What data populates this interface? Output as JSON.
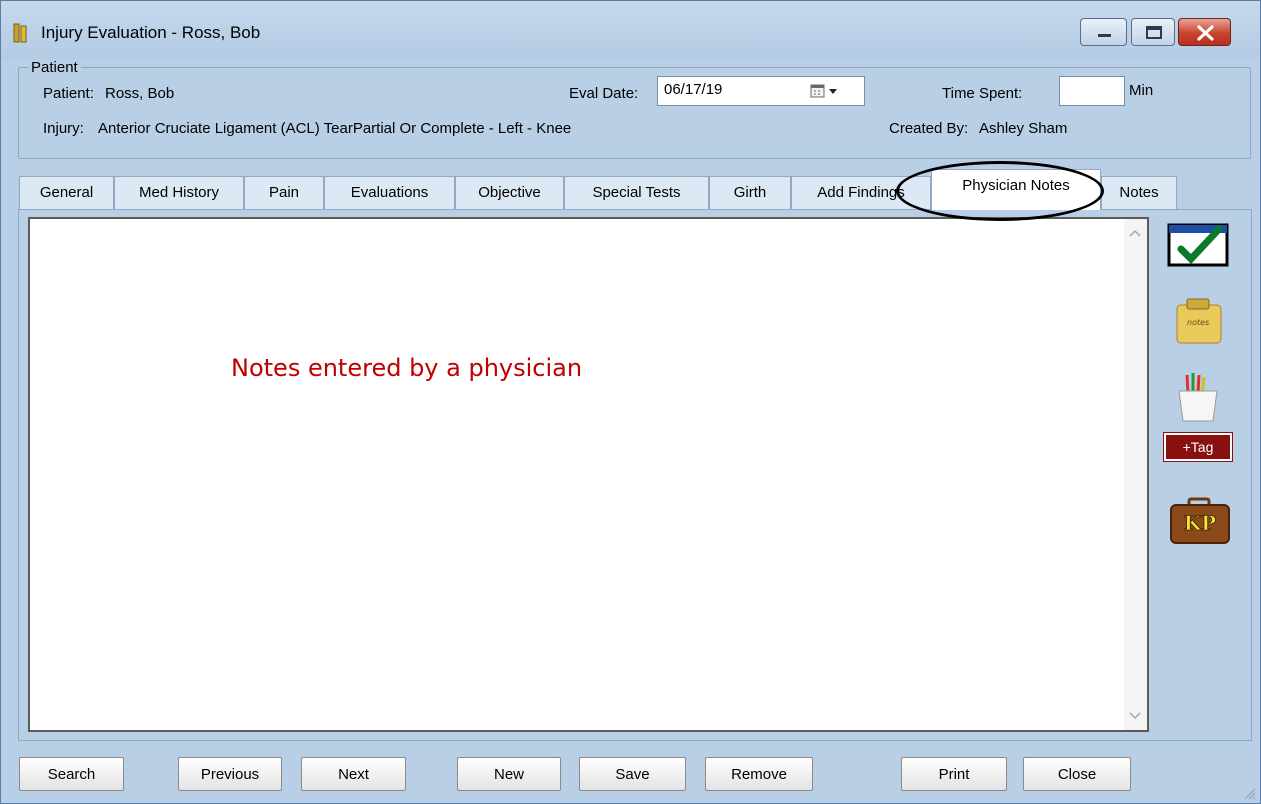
{
  "window": {
    "title": "Injury Evaluation - Ross, Bob"
  },
  "patient_group": {
    "legend": "Patient",
    "patient_label": "Patient:",
    "patient_value": "Ross, Bob",
    "eval_date_label": "Eval Date:",
    "eval_date_value": "06/17/19",
    "time_spent_label": "Time Spent:",
    "time_spent_value": "",
    "time_unit": "Min",
    "injury_label": "Injury:",
    "injury_value": "Anterior Cruciate Ligament (ACL) TearPartial Or Complete - Left - Knee",
    "created_by_label": "Created By:",
    "created_by_value": "Ashley Sham"
  },
  "tabs": [
    {
      "label": "General"
    },
    {
      "label": "Med History"
    },
    {
      "label": "Pain"
    },
    {
      "label": "Evaluations"
    },
    {
      "label": "Objective"
    },
    {
      "label": "Special Tests"
    },
    {
      "label": "Girth"
    },
    {
      "label": "Add Findings"
    },
    {
      "label": "Physician Notes",
      "active": true
    },
    {
      "label": "Notes"
    }
  ],
  "content": {
    "annotation": "Notes entered by a physician"
  },
  "side_toolbar": {
    "tag_label": "+Tag",
    "kp_label": "KP",
    "notes_label": "notes"
  },
  "buttons": {
    "search": "Search",
    "previous": "Previous",
    "next": "Next",
    "new": "New",
    "save": "Save",
    "remove": "Remove",
    "print": "Print",
    "close": "Close"
  },
  "colors": {
    "window_bg": "#b9cfe6",
    "annotation_text": "#c00000",
    "close_button": "#c9432f"
  }
}
